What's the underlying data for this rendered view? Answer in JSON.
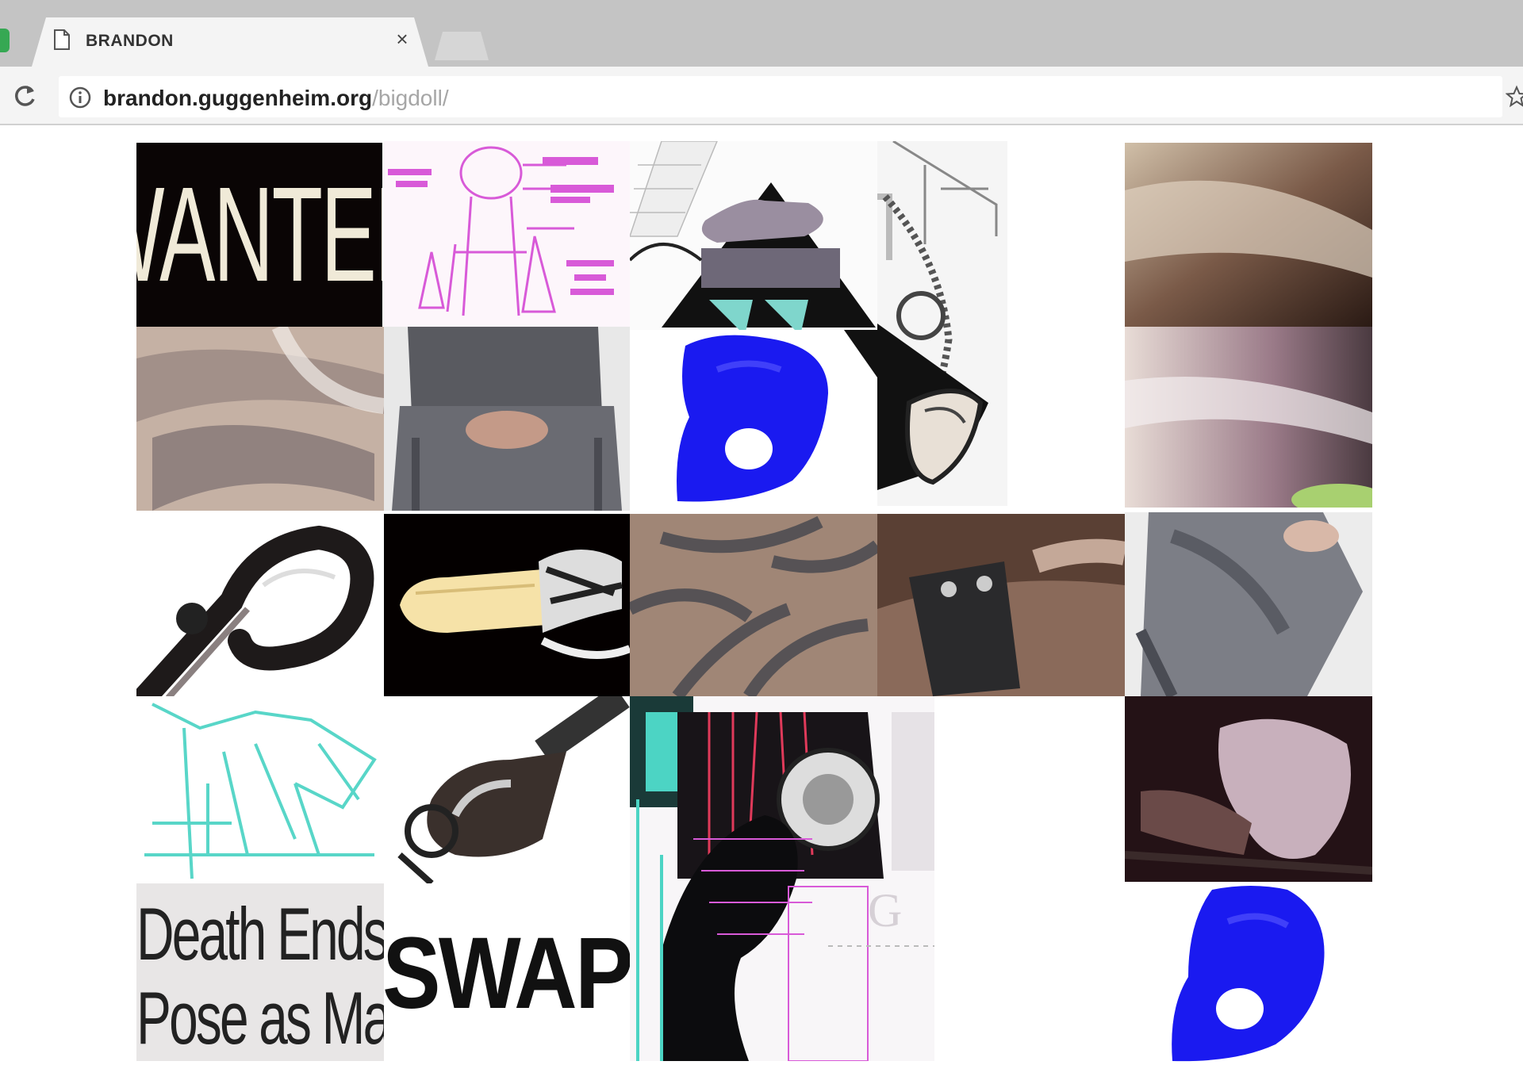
{
  "browser": {
    "tab": {
      "title": "BRANDON",
      "close_glyph": "×"
    },
    "address": {
      "host": "brandon.guggenheim.org",
      "path": "/bigdoll/"
    },
    "icons": [
      "page-icon",
      "close-icon",
      "reload-icon",
      "info-icon",
      "star-icon"
    ]
  },
  "collage": {
    "wanted_text": "WANTED",
    "swap_text": "SWAP",
    "headline_line1": "Death Ends",
    "headline_line2": "Pose as Man",
    "drawing_letter": "G",
    "accent_blue": "#1a1af0",
    "accent_pink": "#d85ad8",
    "accent_teal": "#58d6c8"
  }
}
